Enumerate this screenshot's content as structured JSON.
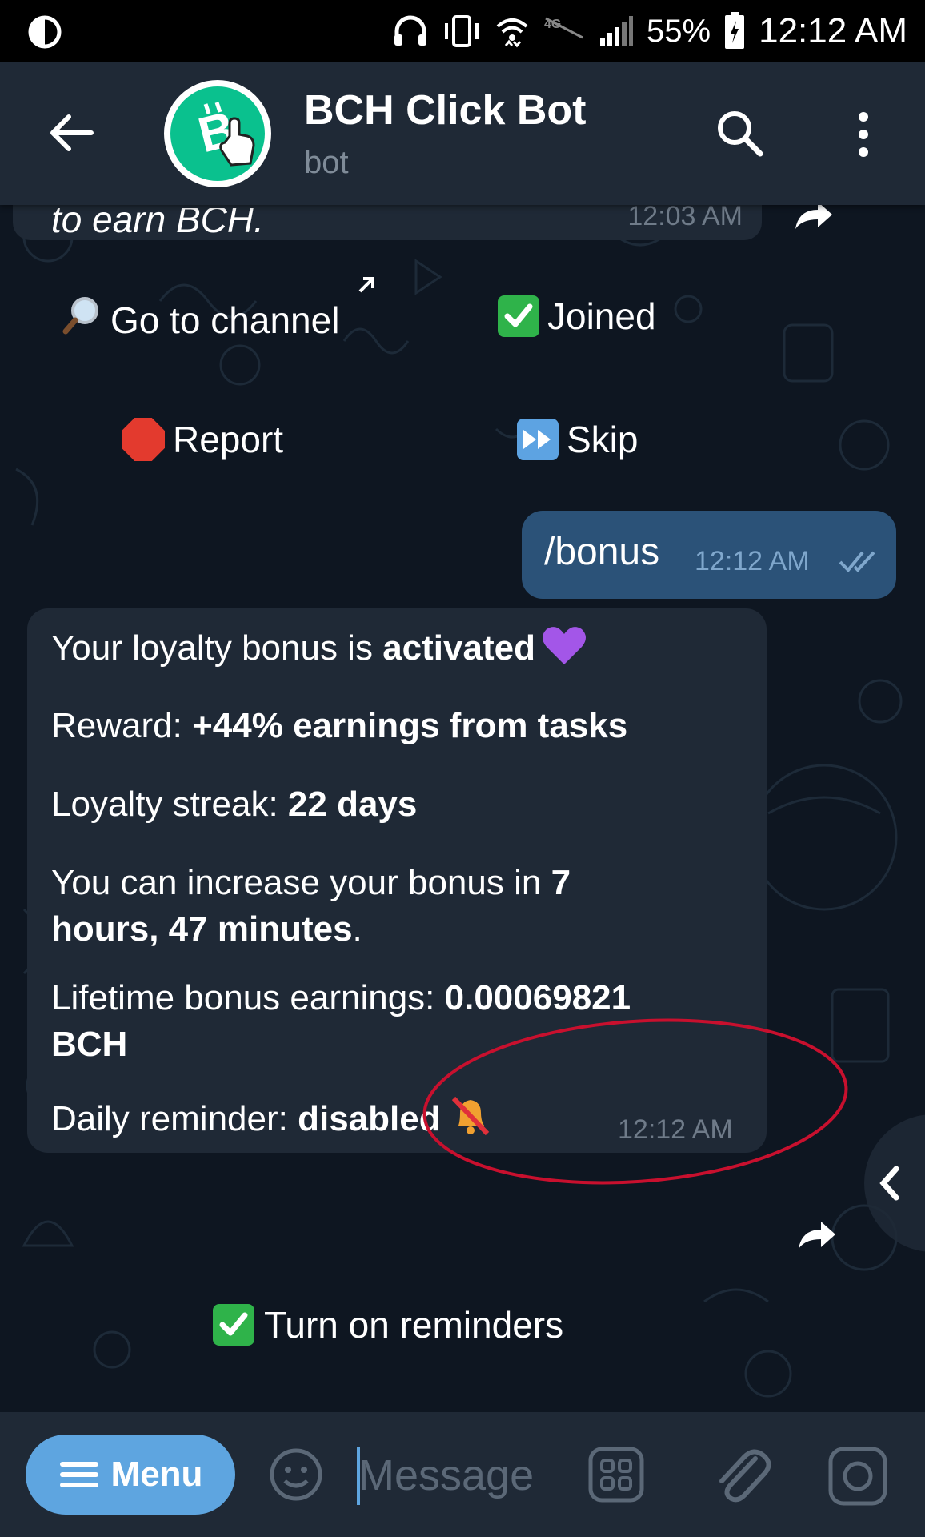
{
  "status_bar": {
    "battery_percent": "55%",
    "time": "12:12 AM",
    "icons": [
      "contrast-icon",
      "headphones-icon",
      "vibrate-icon",
      "wifi-icon",
      "4g-icon",
      "signal-icon",
      "battery-icon"
    ]
  },
  "header": {
    "title": "BCH Click Bot",
    "subtitle": "bot",
    "avatar_icon": "bitcoin-cash-click-icon",
    "accent_color": "#0ac18e"
  },
  "messages": {
    "prev": {
      "text": "to earn BCH.",
      "time": "12:03 AM"
    },
    "keyboard_row1": {
      "go_to_channel": "Go to channel",
      "joined": "Joined"
    },
    "keyboard_row2": {
      "report": "Report",
      "skip": "Skip"
    },
    "outgoing": {
      "text": "/bonus",
      "time": "12:12 AM"
    },
    "bonus": {
      "line1_prefix": "Your loyalty bonus is ",
      "line1_bold": "activated",
      "reward_prefix": "Reward: ",
      "reward_bold": "+44% earnings from tasks",
      "streak_prefix": "Loyalty streak: ",
      "streak_bold": "22 days",
      "increase_prefix": "You can increase your bonus in ",
      "increase_bold_a": "7",
      "increase_bold_b": "hours, 47 minutes",
      "increase_suffix": ".",
      "lifetime_prefix": "Lifetime bonus earnings: ",
      "lifetime_bold_a": "0.00069821",
      "lifetime_bold_b": "BCH",
      "reminder_prefix": "Daily reminder: ",
      "reminder_bold": "disabled",
      "time": "12:12 AM"
    },
    "reminder_button": "Turn on reminders"
  },
  "input_bar": {
    "menu_label": "Menu",
    "placeholder": "Message"
  },
  "colors": {
    "background": "#0e1621",
    "bubble_in": "#1f2936",
    "bubble_out": "#2b5278",
    "menu_button": "#5ea5e0",
    "annotation_circle": "#c8102e"
  }
}
